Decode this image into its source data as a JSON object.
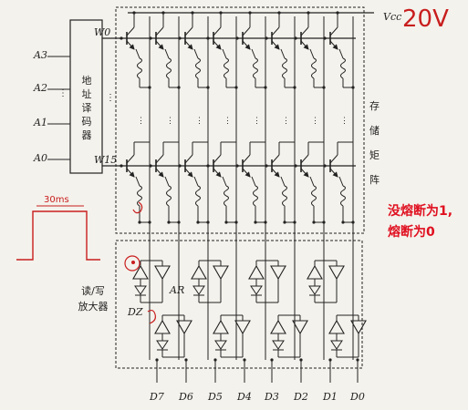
{
  "address_inputs": [
    "A3",
    "A2",
    "A1",
    "A0"
  ],
  "decoder_label": [
    "地",
    "址",
    "译",
    "码",
    "器"
  ],
  "word_lines": {
    "top": "W0",
    "bottom": "W15"
  },
  "vcc_label": "Vcc",
  "vcc_annotation": "20V",
  "array_label": [
    "存",
    "储",
    "矩",
    "阵"
  ],
  "amp_label": [
    "读/写",
    "放大器"
  ],
  "amp_tags": {
    "ar": "AR",
    "dz": "DZ"
  },
  "data_outputs": [
    "D7",
    "D6",
    "D5",
    "D4",
    "D3",
    "D2",
    "D1",
    "D0"
  ],
  "note_line1": "没熔断为1,",
  "note_line2": "熔断为0",
  "pulse_annotation": "30ms",
  "colors": {
    "ink": "#222222",
    "annotation": "#c81e1e",
    "note": "#e01020"
  }
}
